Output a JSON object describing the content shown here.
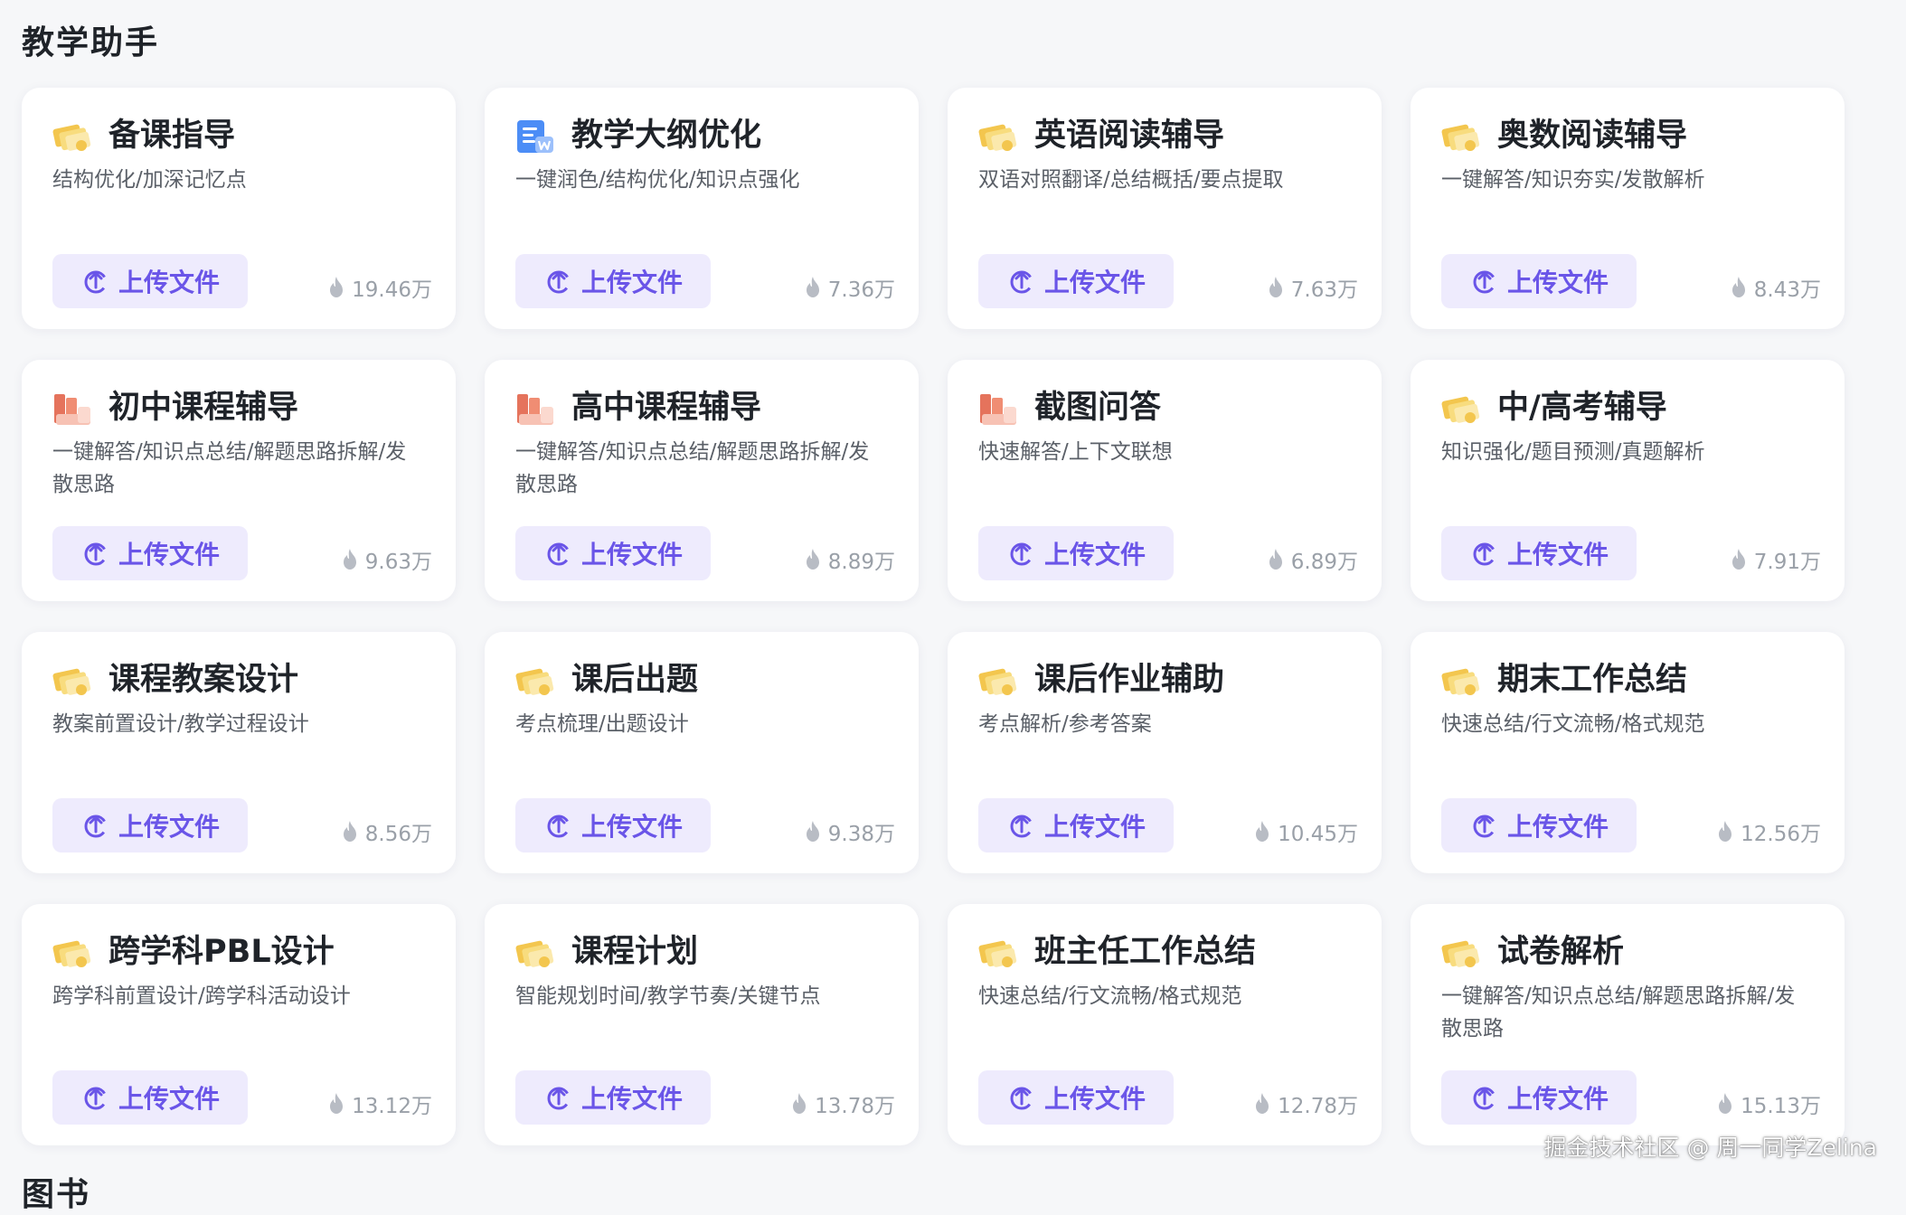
{
  "section": {
    "title": "教学助手",
    "next_title": "图书"
  },
  "upload_label": "上传文件",
  "colors": {
    "accent": "#6a55e8",
    "button_bg": "#eeebfd",
    "heat": "#9aa0a8"
  },
  "cards": [
    {
      "title": "备课指导",
      "desc": "结构优化/加深记忆点",
      "count": "19.46万",
      "icon": "folder-icon"
    },
    {
      "title": "教学大纲优化",
      "desc": "一键润色/结构优化/知识点强化",
      "count": "7.36万",
      "icon": "word-doc-icon"
    },
    {
      "title": "英语阅读辅导",
      "desc": "双语对照翻译/总结概括/要点提取",
      "count": "7.63万",
      "icon": "folder-icon"
    },
    {
      "title": "奥数阅读辅导",
      "desc": "一键解答/知识夯实/发散解析",
      "count": "8.43万",
      "icon": "folder-icon"
    },
    {
      "title": "初中课程辅导",
      "desc": "一键解答/知识点总结/解题思路拆解/发散思路",
      "count": "9.63万",
      "icon": "book-icon"
    },
    {
      "title": "高中课程辅导",
      "desc": "一键解答/知识点总结/解题思路拆解/发散思路",
      "count": "8.89万",
      "icon": "book-icon"
    },
    {
      "title": "截图问答",
      "desc": "快速解答/上下文联想",
      "count": "6.89万",
      "icon": "book-icon"
    },
    {
      "title": "中/高考辅导",
      "desc": "知识强化/题目预测/真题解析",
      "count": "7.91万",
      "icon": "folder-icon"
    },
    {
      "title": "课程教案设计",
      "desc": "教案前置设计/教学过程设计",
      "count": "8.56万",
      "icon": "folder-icon"
    },
    {
      "title": "课后出题",
      "desc": "考点梳理/出题设计",
      "count": "9.38万",
      "icon": "folder-icon"
    },
    {
      "title": "课后作业辅助",
      "desc": "考点解析/参考答案",
      "count": "10.45万",
      "icon": "folder-icon"
    },
    {
      "title": "期末工作总结",
      "desc": "快速总结/行文流畅/格式规范",
      "count": "12.56万",
      "icon": "folder-icon"
    },
    {
      "title": "跨学科PBL设计",
      "desc": "跨学科前置设计/跨学科活动设计",
      "count": "13.12万",
      "icon": "folder-icon"
    },
    {
      "title": "课程计划",
      "desc": "智能规划时间/教学节奏/关键节点",
      "count": "13.78万",
      "icon": "folder-icon"
    },
    {
      "title": "班主任工作总结",
      "desc": "快速总结/行文流畅/格式规范",
      "count": "12.78万",
      "icon": "folder-icon"
    },
    {
      "title": "试卷解析",
      "desc": "一键解答/知识点总结/解题思路拆解/发散思路",
      "count": "15.13万",
      "icon": "folder-icon"
    }
  ],
  "watermark": "掘金技术社区 @ 周一同学Zelina"
}
